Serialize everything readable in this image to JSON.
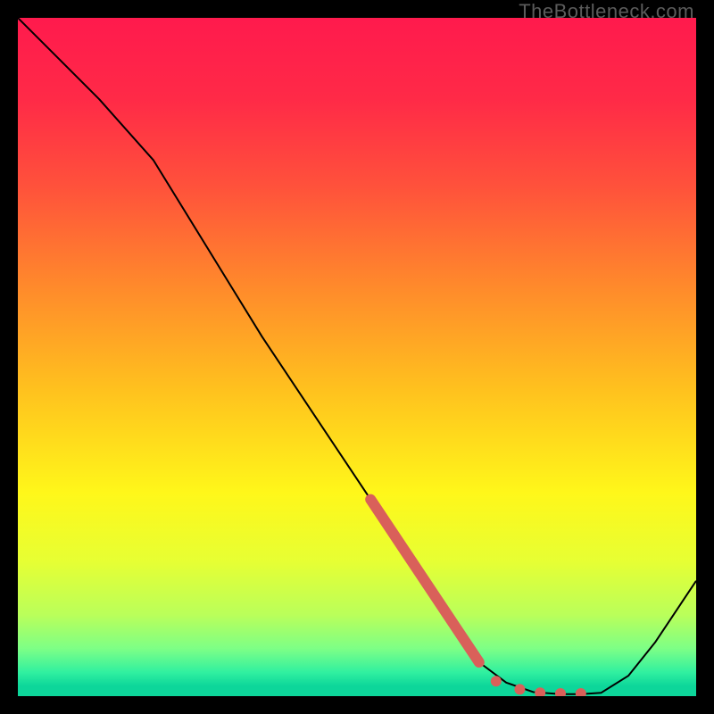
{
  "watermark": "TheBottleneck.com",
  "chart_data": {
    "type": "line",
    "title": "",
    "xlabel": "",
    "ylabel": "",
    "xlim": [
      0,
      100
    ],
    "ylim": [
      0,
      100
    ],
    "grid": false,
    "legend": false,
    "series": [
      {
        "name": "curve",
        "x": [
          0,
          6,
          12,
          20,
          28,
          36,
          44,
          52,
          58,
          62,
          66,
          68,
          72,
          76,
          80,
          83,
          86,
          90,
          94,
          98,
          100
        ],
        "y": [
          100,
          94,
          88,
          79,
          66,
          53,
          41,
          29,
          20,
          14,
          8,
          5,
          2,
          0.6,
          0.3,
          0.3,
          0.5,
          3,
          8,
          14,
          17
        ]
      }
    ],
    "highlight_segments": [
      {
        "kind": "thick",
        "x": [
          52,
          58,
          64,
          68
        ],
        "y": [
          29,
          20,
          11,
          5
        ]
      },
      {
        "kind": "dot",
        "x": 70.5,
        "y": 2.2
      },
      {
        "kind": "dot",
        "x": 74,
        "y": 1.0
      },
      {
        "kind": "dot",
        "x": 77,
        "y": 0.5
      },
      {
        "kind": "dot",
        "x": 80,
        "y": 0.4
      },
      {
        "kind": "dot",
        "x": 83,
        "y": 0.4
      }
    ],
    "gradient_stops": [
      {
        "offset": 0.0,
        "color": "#ff1a4d"
      },
      {
        "offset": 0.12,
        "color": "#ff2a47"
      },
      {
        "offset": 0.25,
        "color": "#ff523b"
      },
      {
        "offset": 0.4,
        "color": "#ff8b2b"
      },
      {
        "offset": 0.55,
        "color": "#ffc21e"
      },
      {
        "offset": 0.7,
        "color": "#fff71a"
      },
      {
        "offset": 0.8,
        "color": "#e7ff33"
      },
      {
        "offset": 0.88,
        "color": "#baff5a"
      },
      {
        "offset": 0.93,
        "color": "#7dff86"
      },
      {
        "offset": 0.965,
        "color": "#30f0a0"
      },
      {
        "offset": 0.985,
        "color": "#0dd69a"
      },
      {
        "offset": 1.0,
        "color": "#0dd69a"
      }
    ],
    "curve_color": "#000000",
    "highlight_color": "#d9605a"
  }
}
